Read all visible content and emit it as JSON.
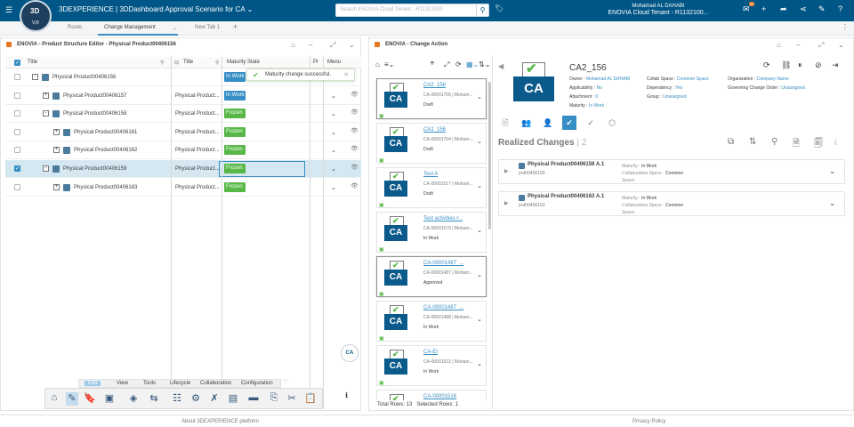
{
  "topbar": {
    "brand_prefix": "3DEXPERIENCE | 3DDashboard",
    "dashboard_name": "Approval Scenario for CA",
    "compass_ds": "3D",
    "compass_vr": "V,R",
    "search_placeholder": "Search ENOVIA Cloud Tenant - R11321000",
    "user_name": "Mohamad AL DAHABI",
    "tenant": "ENOVIA Cloud Tenant - R1132100...",
    "notif_count": "99"
  },
  "tabs": [
    {
      "label": "Route"
    },
    {
      "label": "Change Management"
    },
    {
      "label": "New Tab 1"
    }
  ],
  "left_panel": {
    "title": "ENOVIA - Product Structure Editor - Physical Product00406156",
    "columns": [
      "Title",
      "Title",
      "Maturity State",
      "Pr",
      "Menu"
    ],
    "toast": "Maturity change successful.",
    "rows": [
      {
        "name": "Physical Product00406156",
        "title": "",
        "state": "In Work"
      },
      {
        "name": "Physical Product00406157",
        "title": "Physical Product...",
        "state": "In Work"
      },
      {
        "name": "Physical Product00406158",
        "title": "Physical Product...",
        "state": "Frozen"
      },
      {
        "name": "Physical Product00406161",
        "title": "Physical Product...",
        "state": "Frozen"
      },
      {
        "name": "Physical Product00406162",
        "title": "Physical Product...",
        "state": "Frozen"
      },
      {
        "name": "Physical Product00406159",
        "title": "Physical Product...",
        "state": "Frozen"
      },
      {
        "name": "Physical Product00406163",
        "title": "Physical Product...",
        "state": "Frozen"
      }
    ],
    "menu": [
      "Edit",
      "View",
      "Tools",
      "Lifecycle",
      "Collaboration",
      "Configuration"
    ],
    "ca_float": "CA"
  },
  "right_panel": {
    "title": "ENOVIA - Change Action",
    "cards": [
      {
        "title": "CA2_156",
        "id": "CA-00001705 | Moham...",
        "state": "Draft"
      },
      {
        "title": "CA1_156",
        "id": "CA-00001704 | Moham...",
        "state": "Draft"
      },
      {
        "title": "Test A",
        "id": "CA-00001517 | Moham...",
        "state": "Draft"
      },
      {
        "title": "Test activities r...",
        "id": "CA-00001570 | Moham...",
        "state": "In Work"
      },
      {
        "title": "CA-00001487_...",
        "id": "CA-00001487 | Moham...",
        "state": "Approved"
      },
      {
        "title": "CA-00001487_...",
        "id": "CA-00001488 | Moham...",
        "state": "In Work"
      },
      {
        "title": "CA-EI",
        "id": "CA-00001522 | Moham...",
        "state": "In Work"
      },
      {
        "title": "CA-00001516",
        "id": "",
        "state": ""
      }
    ],
    "total_rows": "Total Rows: 13",
    "selected_rows": "Selected Rows: 1",
    "detail": {
      "title": "CA2_156",
      "ca_label": "CA",
      "owner_label": "Owner :",
      "owner": "Mohamad AL DAHABI",
      "collab_label": "Collab Space :",
      "collab": "Common Space",
      "org_label": "Organization :",
      "org": "Company Name",
      "applicability_label": "Applicability :",
      "applicability": "No",
      "dependency_label": "Dependency :",
      "dependency": "Yes",
      "governing_label": "Governing Change Order :",
      "governing": "Unassigned",
      "attachment_label": "Attachment :",
      "attachment": "0",
      "group_label": "Group :",
      "group": "Unassigned",
      "maturity_label": "Maturity :",
      "maturity": "In Work",
      "realized_title": "Realized Changes",
      "realized_count": "2",
      "realized": [
        {
          "name": "Physical Product00406159 A.1",
          "sub": "prd00406159",
          "maturity_label": "Maturity :",
          "maturity": "In Work",
          "cs_label": "Collaborative Space :",
          "cs": "Common",
          "cs2": "Space"
        },
        {
          "name": "Physical Product00406163 A.1",
          "sub": "prd00406163",
          "maturity_label": "Maturity :",
          "maturity": "In Work",
          "cs_label": "Collaborative Space :",
          "cs": "Common",
          "cs2": "Space"
        }
      ]
    }
  },
  "footer": {
    "about": "About 3DEXPERIENCE platform",
    "privacy": "Privacy Policy"
  },
  "colors": {
    "topbar": "#005686",
    "accent": "#368ec4",
    "frozen": "#57b847",
    "ca_blue": "#0a5a8c"
  }
}
